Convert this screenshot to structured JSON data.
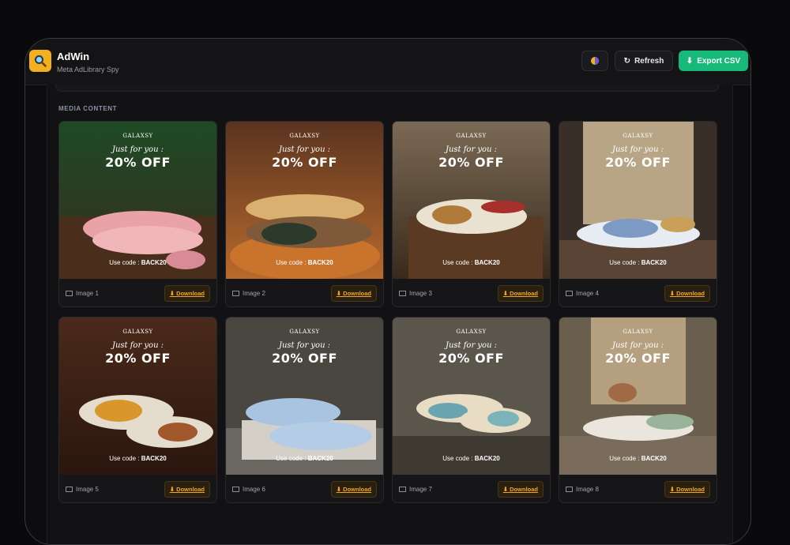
{
  "app": {
    "title": "AdWin",
    "subtitle": "Meta AdLibrary Spy"
  },
  "header": {
    "refresh_label": "Refresh",
    "export_label": "Export CSV",
    "refresh_icon": "refresh-icon",
    "export_icon": "download-icon",
    "theme_icon": "theme-toggle-icon"
  },
  "section": {
    "label": "MEDIA CONTENT"
  },
  "colors": {
    "accent_green": "#17b978",
    "accent_orange": "#f2a623",
    "logo_yellow": "#f2b01e"
  },
  "cards": [
    {
      "label": "Image 1",
      "brand": "GALAXSY",
      "tagline": "Just for you :",
      "offer": "20% OFF",
      "code_prefix": "Use code : ",
      "code": "BACK20",
      "download": "⬇ Download"
    },
    {
      "label": "Image 2",
      "brand": "GALAXSY",
      "tagline": "Just for you :",
      "offer": "20% OFF",
      "code_prefix": "Use code : ",
      "code": "BACK20",
      "download": "⬇ Download"
    },
    {
      "label": "Image 3",
      "brand": "GALAXSY",
      "tagline": "Just for you :",
      "offer": "20% OFF",
      "code_prefix": "Use code : ",
      "code": "BACK20",
      "download": "⬇ Download"
    },
    {
      "label": "Image 4",
      "brand": "GALAXSY",
      "tagline": "Just for you :",
      "offer": "20% OFF",
      "code_prefix": "Use code : ",
      "code": "BACK20",
      "download": "⬇ Download"
    },
    {
      "label": "Image 5",
      "brand": "GALAXSY",
      "tagline": "Just for you :",
      "offer": "20% OFF",
      "code_prefix": "Use code : ",
      "code": "BACK20",
      "download": "⬇ Download"
    },
    {
      "label": "Image 6",
      "brand": "GALAXSY",
      "tagline": "Just for you :",
      "offer": "20% OFF",
      "code_prefix": "Use code : ",
      "code": "BACK20",
      "download": "⬇ Download"
    },
    {
      "label": "Image 7",
      "brand": "GALAXSY",
      "tagline": "Just for you :",
      "offer": "20% OFF",
      "code_prefix": "Use code : ",
      "code": "BACK20",
      "download": "⬇ Download"
    },
    {
      "label": "Image 8",
      "brand": "GALAXSY",
      "tagline": "Just for you :",
      "offer": "20% OFF",
      "code_prefix": "Use code : ",
      "code": "BACK20",
      "download": "⬇ Download"
    }
  ]
}
